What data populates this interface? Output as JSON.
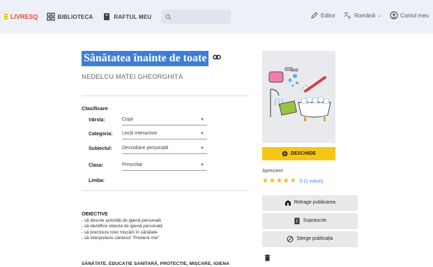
{
  "navbar": {
    "logo": "LIVRESQ",
    "biblioteca": "BIBLIOTECA",
    "raftul": "RAFTUL MEU",
    "editor": "Editor",
    "language": "Română",
    "account": "Contul meu"
  },
  "book": {
    "title": "Sănătatea înainte de toate",
    "author": "NEDELCU MATEI GHEORGHIȚA"
  },
  "classification": {
    "heading": "Clasificare",
    "fields": [
      {
        "label": "Vârsta:",
        "value": "Copii"
      },
      {
        "label": "Categoria:",
        "value": "Lecții interactive"
      },
      {
        "label": "Subiectul:",
        "value": "Dezvoltare personală"
      },
      {
        "label": "Clasa:",
        "value": "Preșcolar"
      },
      {
        "label": "Limba:",
        "value": ""
      }
    ]
  },
  "objectives": {
    "heading": "OBIECTIVE",
    "items": [
      "- să descrie activități de igienă personală",
      "- să identifice obiecte de igienă personală",
      "- să precizeze rolul mișcării în sănătate",
      "- să interpreteze cântecul \"Prietenii mei\""
    ]
  },
  "tags": "SĂNĂTATE, EDUCAȚIE SANITARĂ, PROTECȚIE, MIȘCARE, IGIENA",
  "sidebar": {
    "open_button": "DESCHIDE",
    "rating_label": "Apreciere",
    "rating_stars": 5,
    "rating_text": "5 (1 voturi)",
    "withdraw_button": "Retrage publicarea",
    "overwrite_button": "Suprascrie",
    "delete_button": "Șterge publicația"
  },
  "colors": {
    "title_highlight": "#3b7ed8",
    "open_button": "#f5c518",
    "stars": "#f5b800",
    "logo": "#e0502b"
  }
}
